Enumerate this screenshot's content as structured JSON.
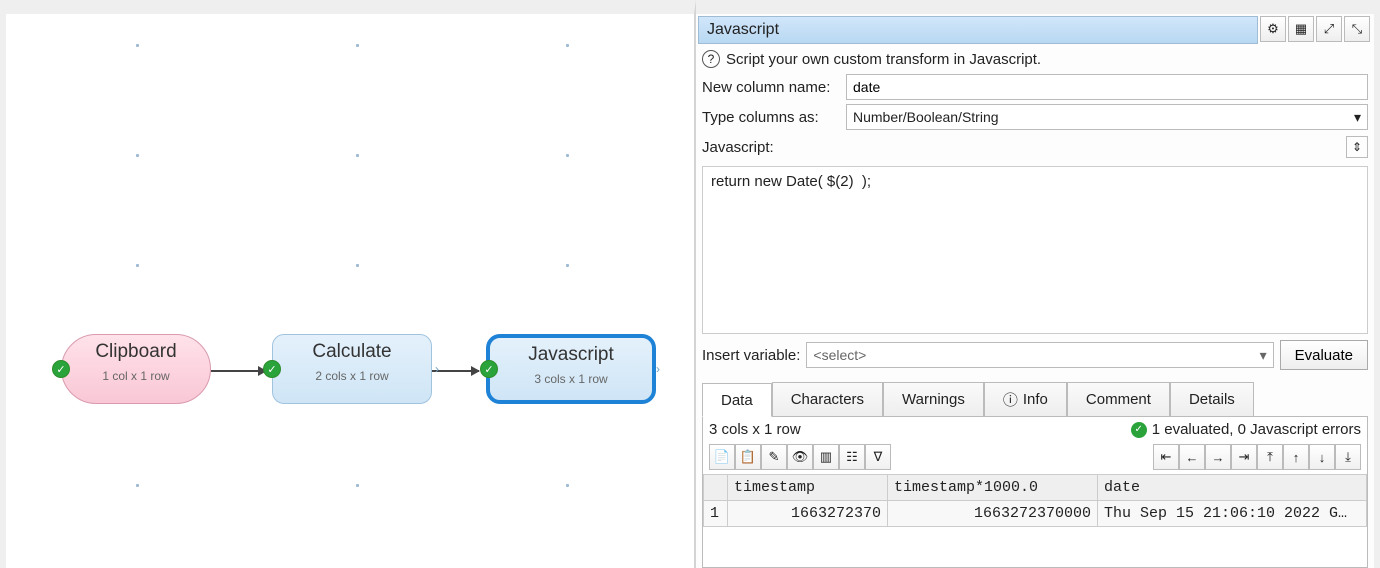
{
  "panel": {
    "title": "Javascript",
    "hint": "Script your own custom transform in Javascript.",
    "new_column_label": "New column name:",
    "new_column_value": "date",
    "type_label": "Type columns as:",
    "type_value": "Number/Boolean/String",
    "js_label": "Javascript:",
    "js_code": "return new Date( $(2)  );",
    "insert_label": "Insert variable:",
    "insert_placeholder": "<select>",
    "evaluate_label": "Evaluate"
  },
  "tabs": {
    "data": "Data",
    "characters": "Characters",
    "warnings": "Warnings",
    "info": "Info",
    "comment": "Comment",
    "details": "Details"
  },
  "results": {
    "dims": "3 cols x 1 row",
    "status": "1 evaluated, 0 Javascript errors",
    "columns": [
      "",
      "timestamp",
      "timestamp*1000.0",
      "date"
    ],
    "row": [
      "1",
      "1663272370",
      "1663272370000",
      "Thu Sep 15 21:06:10 2022 G…"
    ]
  },
  "nodes": {
    "clipboard": {
      "title": "Clipboard",
      "sub": "1 col x 1 row"
    },
    "calculate": {
      "title": "Calculate",
      "sub": "2 cols x 1 row"
    },
    "javascript": {
      "title": "Javascript",
      "sub": "3 cols x 1 row"
    }
  }
}
